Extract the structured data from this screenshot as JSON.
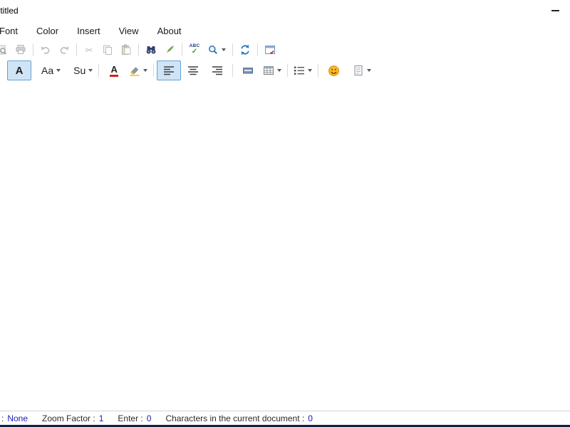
{
  "window": {
    "title": "Untitled"
  },
  "menu": {
    "items": [
      {
        "label": "Font"
      },
      {
        "label": "Color"
      },
      {
        "label": "Insert"
      },
      {
        "label": "View"
      },
      {
        "label": "About"
      }
    ]
  },
  "glyphs": {
    "cut": "✂",
    "check": "✓"
  },
  "toolbar_main": {
    "spellcheck_text": "ABC",
    "icons": [
      "print-preview-icon",
      "print-icon",
      "undo-icon",
      "redo-icon",
      "cut-icon",
      "copy-icon",
      "paste-icon",
      "find-icon",
      "pencil-icon",
      "spellcheck-icon",
      "zoom-icon",
      "refresh-icon",
      "calendar-icon"
    ]
  },
  "toolbar_format": {
    "bold_label": "A",
    "case_label": "Aa",
    "script_label": "Su",
    "font_color_label": "A",
    "icons": [
      "font-color-icon",
      "highlighter-icon",
      "align-left-icon",
      "align-center-icon",
      "align-right-icon",
      "horizontal-line-icon",
      "table-icon",
      "list-icon",
      "emoji-icon",
      "document-icon"
    ]
  },
  "status_bar": {
    "items": [
      {
        "label": ":",
        "value": "None"
      },
      {
        "label": "Zoom Factor :",
        "value": "1"
      },
      {
        "label": "Enter :",
        "value": "0"
      },
      {
        "label": "Characters in the current document :",
        "value": "0"
      }
    ]
  },
  "colors": {
    "selected_bg": "#cfe4f7",
    "selected_border": "#66a1d4",
    "status_value_blue": "#1a1ab4",
    "accent_blue": "#2a7ad0",
    "bottom_edge": "#13203f"
  }
}
